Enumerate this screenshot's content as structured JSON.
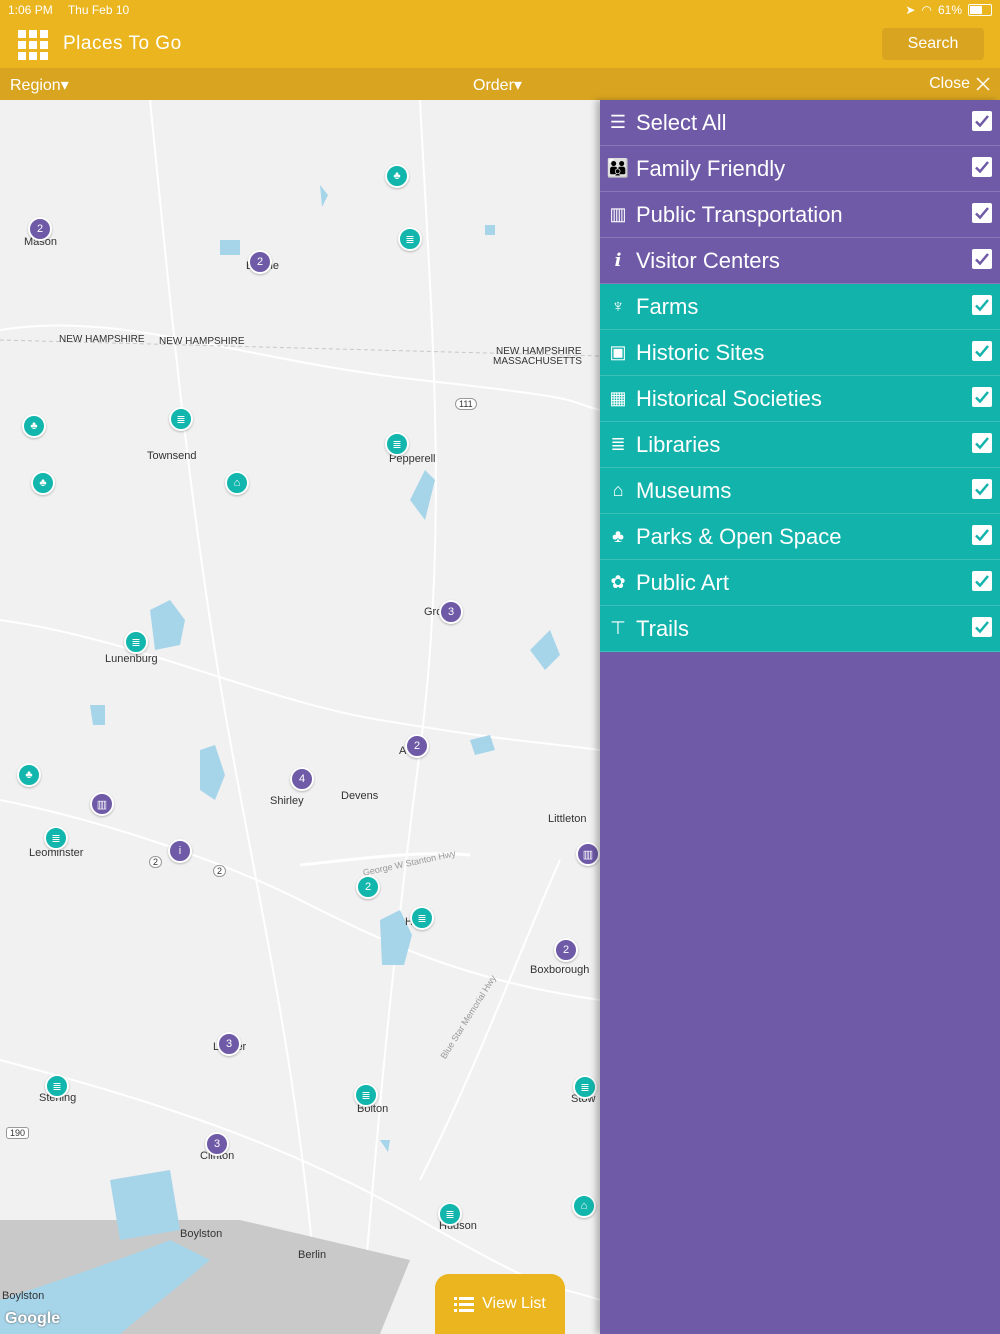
{
  "status": {
    "time": "1:06 PM",
    "date": "Thu Feb 10",
    "battery": "61%",
    "battery_level": 0.61
  },
  "header": {
    "title": "Places To Go",
    "search_label": "Search"
  },
  "filters": {
    "region_label": "Region▾",
    "order_label": "Order▾",
    "close_label": "Close"
  },
  "map": {
    "towns": [
      "Mason",
      "B  kline",
      "NEW HAMPSHIRE",
      "NEW HAMPSHIRE",
      "NEW HAMPSHIRE",
      "MASSACHUSETTS",
      "Townsend",
      "Pepperell",
      "Gro",
      "Lunenburg",
      "Shirley",
      "Devens",
      "A",
      "Littleton",
      "Leominster",
      "H   ard",
      "Boxborough",
      "L   aster",
      "Sterling",
      "Bolton",
      "Stow",
      "Clinton",
      "Hudson",
      "Boylston",
      "Berlin",
      "Boylston"
    ],
    "roads": [
      "111",
      "2",
      "2",
      "190",
      "George W Stanton Hwy",
      "Blue Star Memorial Hwy"
    ],
    "cluster_counts": [
      "2",
      "2",
      "3",
      "2",
      "4",
      "2",
      "2",
      "3",
      "3"
    ],
    "attribution": "Google"
  },
  "view_list_label": "View List",
  "categories": [
    {
      "label": "Select All",
      "icon": "select-all-icon",
      "checked": true,
      "group": "purple"
    },
    {
      "label": "Family Friendly",
      "icon": "family-icon",
      "checked": true,
      "group": "purple"
    },
    {
      "label": "Public Transportation",
      "icon": "map-icon",
      "checked": true,
      "group": "purple"
    },
    {
      "label": "Visitor Centers",
      "icon": "info-icon",
      "checked": true,
      "group": "purple"
    },
    {
      "label": "Farms",
      "icon": "farm-icon",
      "checked": true,
      "group": "teal"
    },
    {
      "label": "Historic Sites",
      "icon": "book-icon",
      "checked": true,
      "group": "teal"
    },
    {
      "label": "Historical Societies",
      "icon": "building-icon",
      "checked": true,
      "group": "teal"
    },
    {
      "label": "Libraries",
      "icon": "library-icon",
      "checked": true,
      "group": "teal"
    },
    {
      "label": "Museums",
      "icon": "museum-icon",
      "checked": true,
      "group": "teal"
    },
    {
      "label": "Parks & Open Space",
      "icon": "tree-icon",
      "checked": true,
      "group": "teal"
    },
    {
      "label": "Public Art",
      "icon": "palette-icon",
      "checked": true,
      "group": "teal"
    },
    {
      "label": "Trails",
      "icon": "signpost-icon",
      "checked": true,
      "group": "teal"
    }
  ],
  "colors": {
    "header": "#ebb51f",
    "purple": "#6f5aa7",
    "teal": "#12b3ab"
  }
}
